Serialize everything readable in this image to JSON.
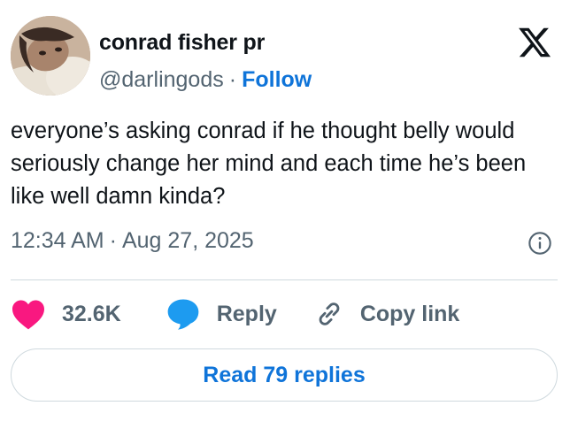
{
  "author": {
    "name": "conrad fisher pr",
    "handle": "@darlingods",
    "separator": "·",
    "follow_label": "Follow"
  },
  "tweet": {
    "text": "everyone’s asking conrad if he thought belly would seriously change her mind and each time he’s been like well damn kinda?",
    "time": "12:34 AM",
    "separator": "·",
    "date": "Aug 27, 2025"
  },
  "actions": {
    "likes_count": "32.6K",
    "reply_label": "Reply",
    "copy_link_label": "Copy link"
  },
  "read_replies_label": "Read 79 replies",
  "icons": {
    "logo": "x-logo-icon",
    "info": "info-icon",
    "like": "heart-icon",
    "reply": "speech-bubble-icon",
    "copy": "link-icon"
  },
  "colors": {
    "heart": "#f91880",
    "reply_bubble": "#1d9bf0",
    "follow": "#0f74d9",
    "secondary_text": "#536471",
    "divider": "#cfd9de"
  }
}
